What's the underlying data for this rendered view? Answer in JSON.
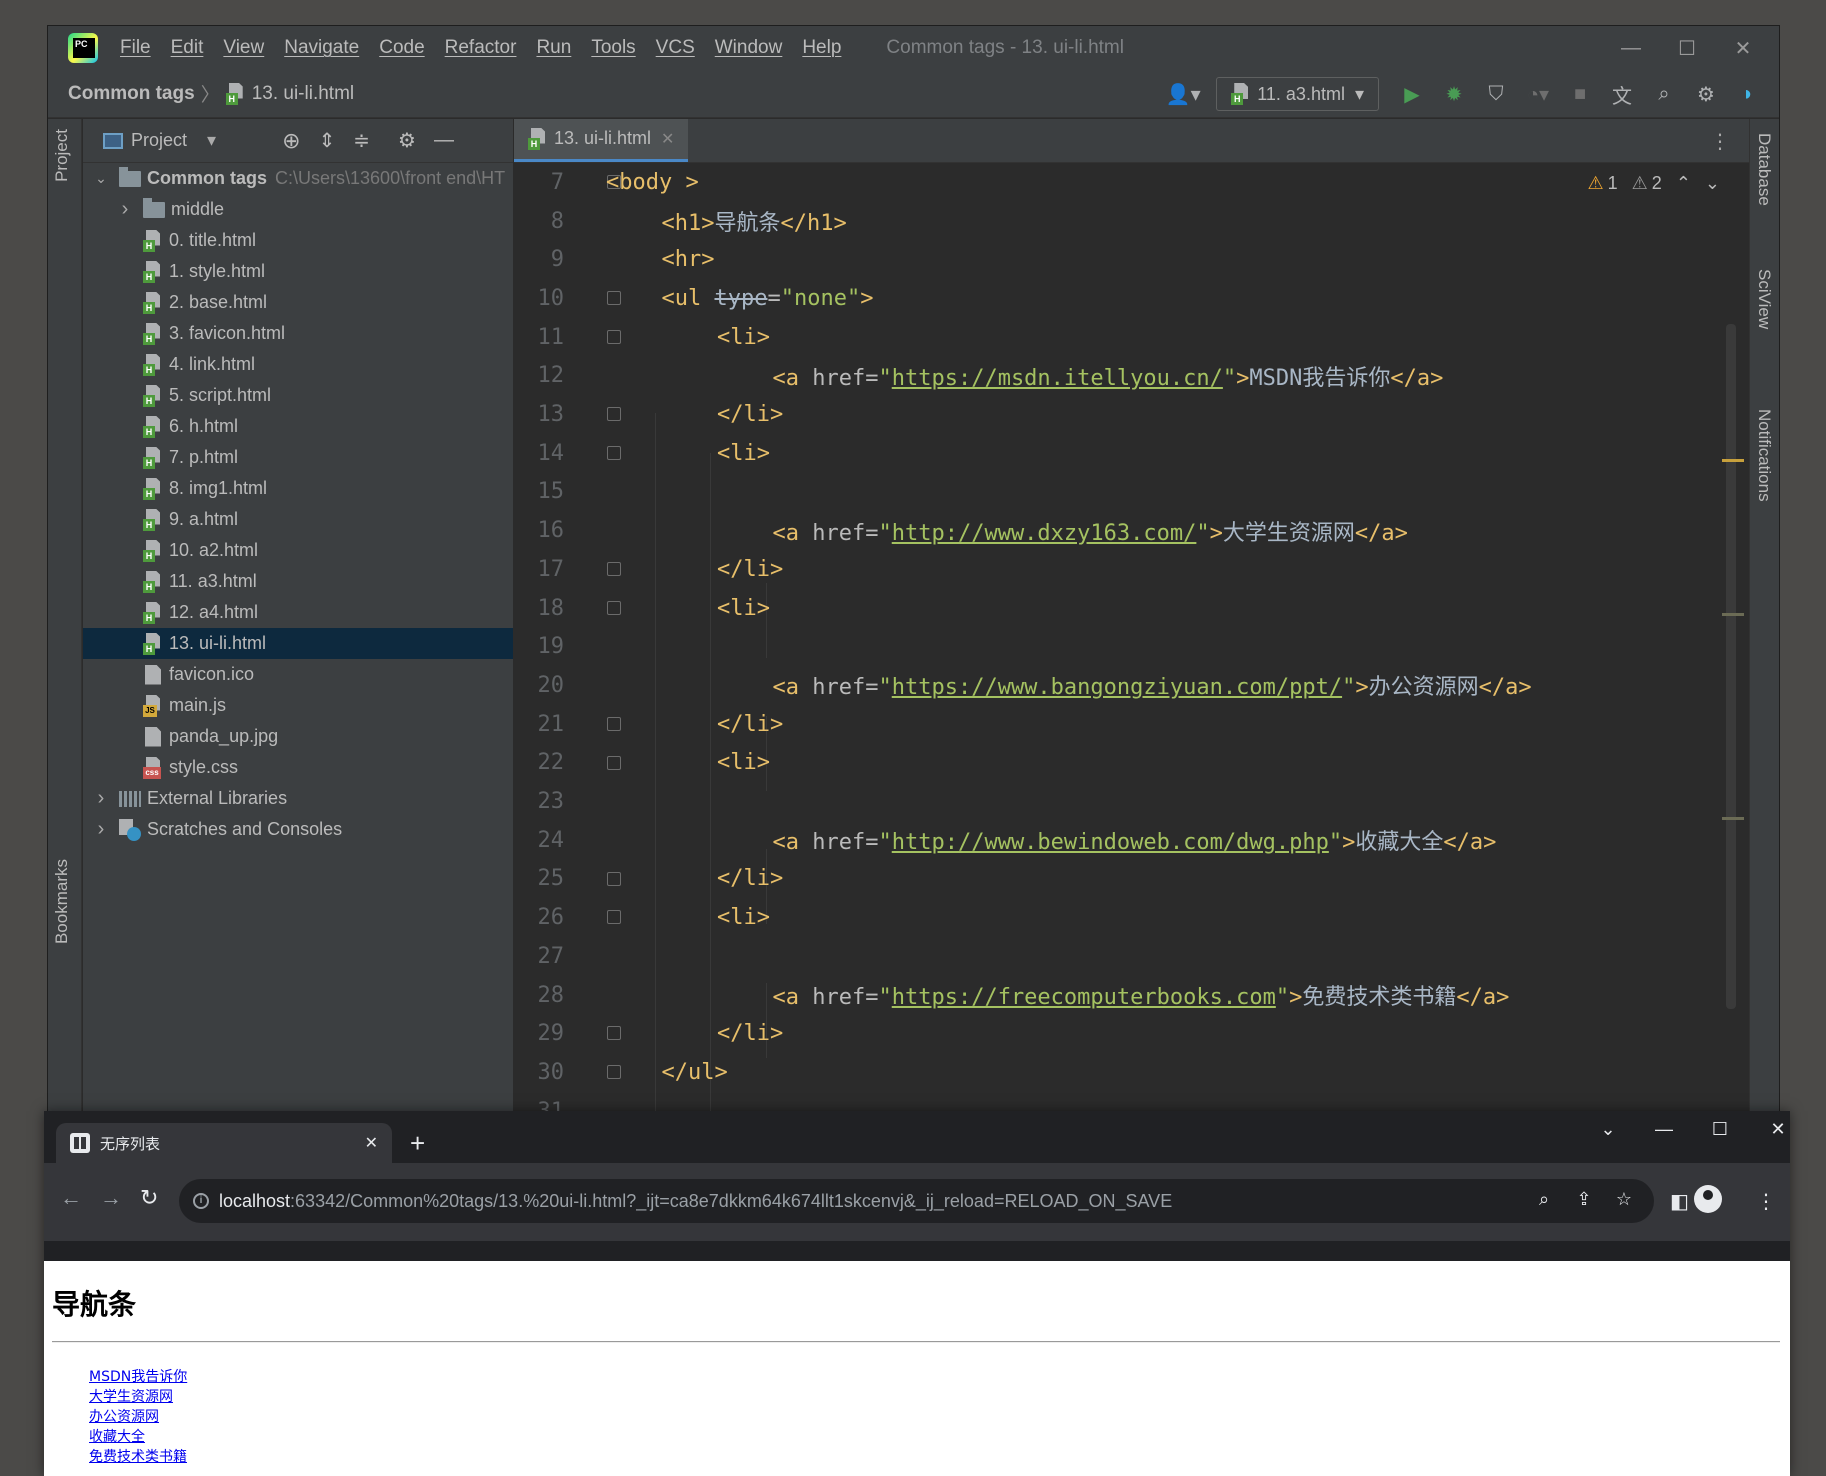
{
  "ide": {
    "menu": [
      "File",
      "Edit",
      "View",
      "Navigate",
      "Code",
      "Refactor",
      "Run",
      "Tools",
      "VCS",
      "Window",
      "Help"
    ],
    "window_title": "Common tags - 13. ui-li.html",
    "breadcrumb": {
      "root": "Common tags",
      "file": "13. ui-li.html"
    },
    "run_config": "11. a3.html",
    "project_panel": {
      "title": "Project",
      "root": {
        "name": "Common tags",
        "path": "C:\\Users\\13600\\front end\\HT"
      },
      "items": [
        {
          "name": "middle",
          "type": "folder"
        },
        {
          "name": "0. title.html",
          "type": "html"
        },
        {
          "name": "1. style.html",
          "type": "html"
        },
        {
          "name": "2. base.html",
          "type": "html"
        },
        {
          "name": "3. favicon.html",
          "type": "html"
        },
        {
          "name": "4. link.html",
          "type": "html"
        },
        {
          "name": "5. script.html",
          "type": "html"
        },
        {
          "name": "6. h.html",
          "type": "html"
        },
        {
          "name": "7. p.html",
          "type": "html"
        },
        {
          "name": "8. img1.html",
          "type": "html"
        },
        {
          "name": "9. a.html",
          "type": "html"
        },
        {
          "name": "10. a2.html",
          "type": "html"
        },
        {
          "name": "11. a3.html",
          "type": "html"
        },
        {
          "name": "12. a4.html",
          "type": "html"
        },
        {
          "name": "13. ui-li.html",
          "type": "html",
          "selected": true
        },
        {
          "name": "favicon.ico",
          "type": "plain"
        },
        {
          "name": "main.js",
          "type": "js"
        },
        {
          "name": "panda_up.jpg",
          "type": "plain"
        },
        {
          "name": "style.css",
          "type": "css"
        }
      ],
      "extra": [
        "External Libraries",
        "Scratches and Consoles"
      ]
    },
    "side_tabs": {
      "left_top": "Project",
      "left_bottom": "Bookmarks",
      "right": [
        "Database",
        "SciView",
        "Notifications"
      ]
    },
    "editor_tab": "13. ui-li.html",
    "inspections": {
      "warnings": "1",
      "weak_warnings": "2"
    },
    "code_lines": [
      {
        "n": "7",
        "tokens": [
          [
            "tag",
            "<body "
          ],
          [
            "tag",
            ">"
          ]
        ],
        "indent": 0
      },
      {
        "n": "8",
        "tokens": [
          [
            "tag",
            "<h1>"
          ],
          [
            "txt",
            "导航条"
          ],
          [
            "tag",
            "</h1>"
          ]
        ],
        "indent": 1
      },
      {
        "n": "9",
        "tokens": [
          [
            "tag",
            "<hr>"
          ]
        ],
        "indent": 1
      },
      {
        "n": "10",
        "tokens": [
          [
            "tag",
            "<ul "
          ],
          [
            "strike",
            "type"
          ],
          [
            "attr",
            "="
          ],
          [
            "val",
            "\"none\""
          ],
          [
            "tag",
            ">"
          ]
        ],
        "indent": 1
      },
      {
        "n": "11",
        "tokens": [
          [
            "tag",
            "<li>"
          ]
        ],
        "indent": 2
      },
      {
        "n": "12",
        "tokens": [
          [
            "tag",
            "<a "
          ],
          [
            "attr",
            "href="
          ],
          [
            "val",
            "\""
          ],
          [
            "url",
            "https://msdn.itellyou.cn/"
          ],
          [
            "val",
            "\""
          ],
          [
            "tag",
            ">"
          ],
          [
            "txt",
            "MSDN我告诉你"
          ],
          [
            "tag",
            "</a>"
          ]
        ],
        "indent": 3
      },
      {
        "n": "13",
        "tokens": [
          [
            "tag",
            "</li>"
          ]
        ],
        "indent": 2
      },
      {
        "n": "14",
        "tokens": [
          [
            "tag",
            "<li>"
          ]
        ],
        "indent": 2
      },
      {
        "n": "15",
        "tokens": [],
        "indent": 0
      },
      {
        "n": "16",
        "tokens": [
          [
            "tag",
            "<a "
          ],
          [
            "attr",
            "href="
          ],
          [
            "val",
            "\""
          ],
          [
            "url",
            "http://www.dxzy163.com/"
          ],
          [
            "val",
            "\""
          ],
          [
            "tag",
            ">"
          ],
          [
            "txt",
            "大学生资源网"
          ],
          [
            "tag",
            "</a>"
          ]
        ],
        "indent": 3
      },
      {
        "n": "17",
        "tokens": [
          [
            "tag",
            "</li>"
          ]
        ],
        "indent": 2
      },
      {
        "n": "18",
        "tokens": [
          [
            "tag",
            "<li>"
          ]
        ],
        "indent": 2
      },
      {
        "n": "19",
        "tokens": [],
        "indent": 0
      },
      {
        "n": "20",
        "tokens": [
          [
            "tag",
            "<a "
          ],
          [
            "attr",
            "href="
          ],
          [
            "val",
            "\""
          ],
          [
            "url",
            "https://www.bangongziyuan.com/ppt/"
          ],
          [
            "val",
            "\""
          ],
          [
            "tag",
            ">"
          ],
          [
            "txt",
            "办公资源网"
          ],
          [
            "tag",
            "</a>"
          ]
        ],
        "indent": 3
      },
      {
        "n": "21",
        "tokens": [
          [
            "tag",
            "</li>"
          ]
        ],
        "indent": 2
      },
      {
        "n": "22",
        "tokens": [
          [
            "tag",
            "<li>"
          ]
        ],
        "indent": 2
      },
      {
        "n": "23",
        "tokens": [],
        "indent": 0
      },
      {
        "n": "24",
        "tokens": [
          [
            "tag",
            "<a "
          ],
          [
            "attr",
            "href="
          ],
          [
            "val",
            "\""
          ],
          [
            "url",
            "http://www.bewindoweb.com/dwg.php"
          ],
          [
            "val",
            "\""
          ],
          [
            "tag",
            ">"
          ],
          [
            "txt",
            "收藏大全"
          ],
          [
            "tag",
            "</a>"
          ]
        ],
        "indent": 3
      },
      {
        "n": "25",
        "tokens": [
          [
            "tag",
            "</li>"
          ]
        ],
        "indent": 2
      },
      {
        "n": "26",
        "tokens": [
          [
            "tag",
            "<li>"
          ]
        ],
        "indent": 2
      },
      {
        "n": "27",
        "tokens": [],
        "indent": 0
      },
      {
        "n": "28",
        "tokens": [
          [
            "tag",
            "<a "
          ],
          [
            "attr",
            "href="
          ],
          [
            "val",
            "\""
          ],
          [
            "url",
            "https://freecomputerbooks.com"
          ],
          [
            "val",
            "\""
          ],
          [
            "tag",
            ">"
          ],
          [
            "txt",
            "免费技术类书籍"
          ],
          [
            "tag",
            "</a>"
          ]
        ],
        "indent": 3
      },
      {
        "n": "29",
        "tokens": [
          [
            "tag",
            "</li>"
          ]
        ],
        "indent": 2
      },
      {
        "n": "30",
        "tokens": [
          [
            "tag",
            "</ul>"
          ]
        ],
        "indent": 1
      },
      {
        "n": "31",
        "tokens": [],
        "indent": 0
      }
    ]
  },
  "browser": {
    "tab_title": "无序列表",
    "url_host": "localhost",
    "url_rest": ":63342/Common%20tags/13.%20ui-li.html?_ijt=ca8e7dkkm64k674llt1skcenvj&_ij_reload=RELOAD_ON_SAVE",
    "page": {
      "heading": "导航条",
      "links": [
        "MSDN我告诉你",
        "大学生资源网",
        "办公资源网",
        "收藏大全",
        "免费技术类书籍"
      ]
    }
  },
  "colors": {
    "tag": "#e8bf6a",
    "string": "#a5c261",
    "text": "#a9b7c6",
    "selection": "#0d293e",
    "link": "#0000ee"
  }
}
